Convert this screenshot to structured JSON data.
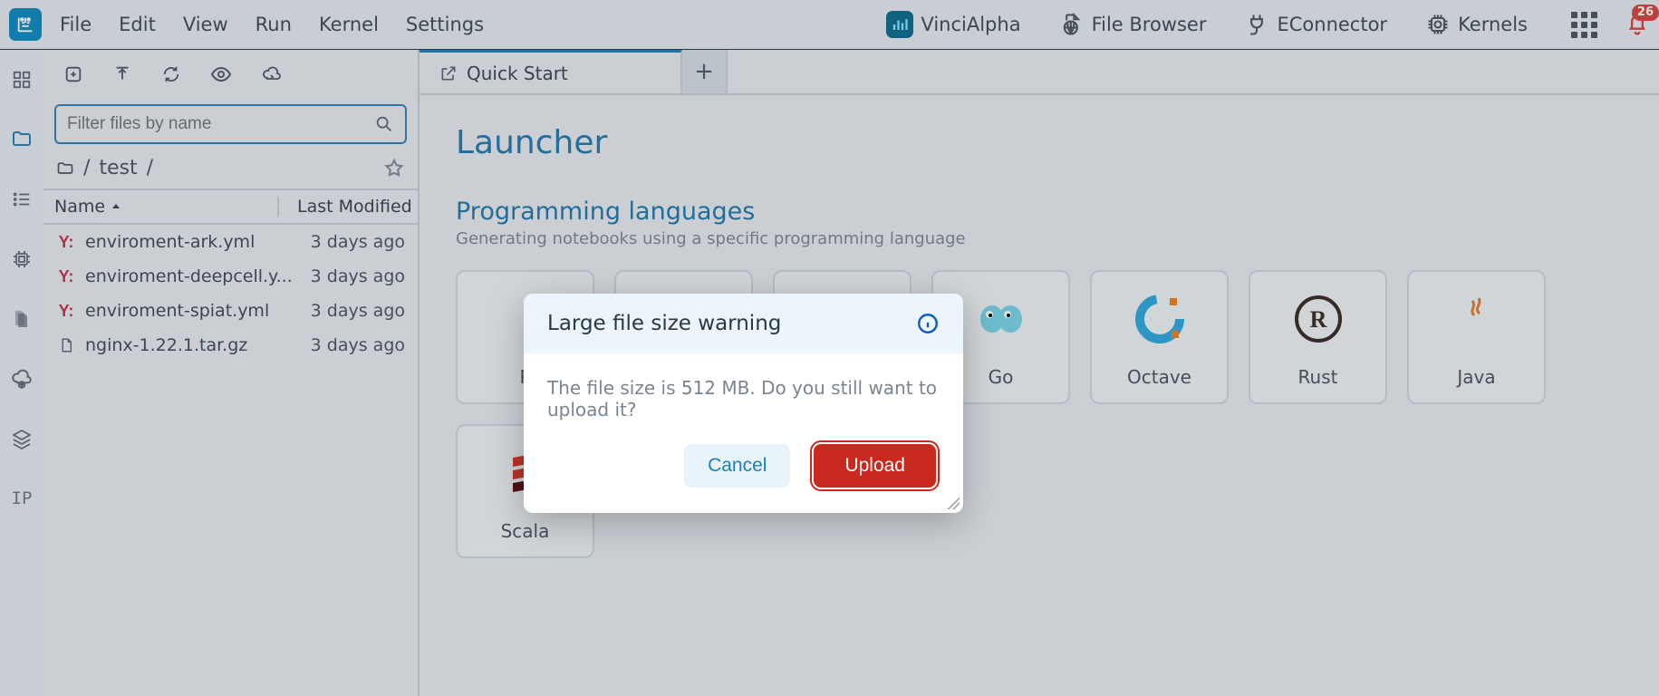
{
  "menu": {
    "items": [
      "File",
      "Edit",
      "View",
      "Run",
      "Kernel",
      "Settings"
    ]
  },
  "topbar": {
    "vincialpha": "VinciAlpha",
    "filebrowser": "File Browser",
    "econnector": "EConnector",
    "kernels": "Kernels",
    "badge": "26",
    "ip": "IP"
  },
  "filepanel": {
    "filter_placeholder": "Filter files by name",
    "breadcrumb_parts": [
      "/",
      "test",
      "/"
    ],
    "col_name": "Name",
    "col_mod": "Last Modified",
    "files": [
      {
        "icon": "yaml",
        "name": "enviroment-ark.yml",
        "mod": "3 days ago"
      },
      {
        "icon": "yaml",
        "name": "enviroment-deepcell.y...",
        "mod": "3 days ago"
      },
      {
        "icon": "yaml",
        "name": "enviroment-spiat.yml",
        "mod": "3 days ago"
      },
      {
        "icon": "file",
        "name": "nginx-1.22.1.tar.gz",
        "mod": "3 days ago"
      }
    ]
  },
  "tabs": {
    "active": "Quick Start"
  },
  "launcher": {
    "title": "Launcher",
    "section_title": "Programming languages",
    "section_sub": "Generating notebooks using a specific programming language",
    "langs": [
      "P",
      "",
      "",
      "Go",
      "Octave",
      "Rust",
      "Java",
      "Scala"
    ]
  },
  "modal": {
    "title": "Large file size warning",
    "body": "The file size is 512 MB. Do you still want to upload it?",
    "cancel": "Cancel",
    "upload": "Upload"
  }
}
